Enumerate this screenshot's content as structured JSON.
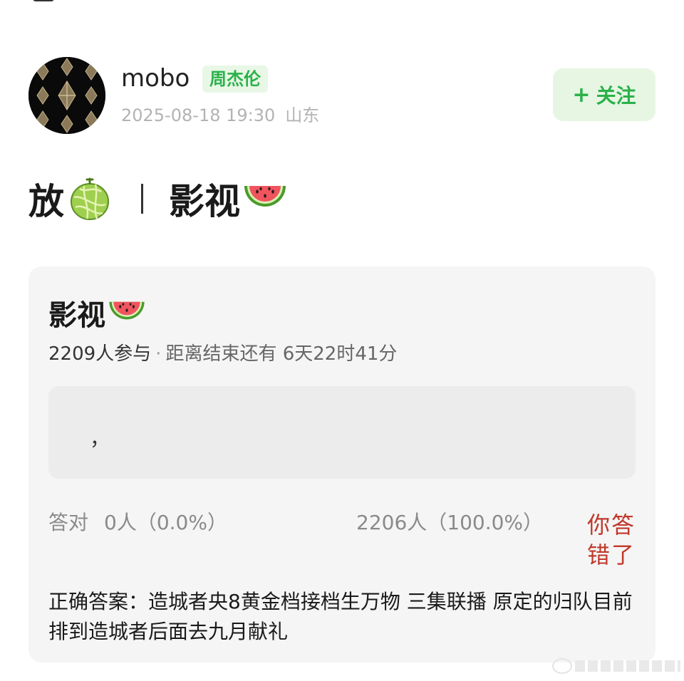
{
  "post": {
    "username": "mobo",
    "tag": "周杰伦",
    "date": "2025-08-18 19:30",
    "location": "山东",
    "follow_plus": "+",
    "follow_label": "关注",
    "title_left": "放",
    "title_right": "影视"
  },
  "quiz": {
    "title": "影视",
    "participants": "2209人参与",
    "dot": "·",
    "countdown": "距离结束还有 6天22时41分",
    "option_text": "，",
    "correct_label": "答对",
    "correct_stat": "0人（0.0%）",
    "other_stat": "2206人（100.0%）",
    "wrong_label": "你答错了",
    "answer": "正确答案：造城者央8黄金档接档生万物 三集联播 原定的归队目前排到造城者后面去九月献礼"
  },
  "icons": {
    "avatar": "avatar-pattern",
    "melon": "melon-icon",
    "watermelon": "watermelon-icon",
    "watermark": "watermark-logo"
  },
  "colors": {
    "accent_green": "#2bb14a",
    "tag_bg": "#e8f7e6",
    "wrong_red": "#c0392b",
    "card_bg": "#f5f5f5"
  }
}
